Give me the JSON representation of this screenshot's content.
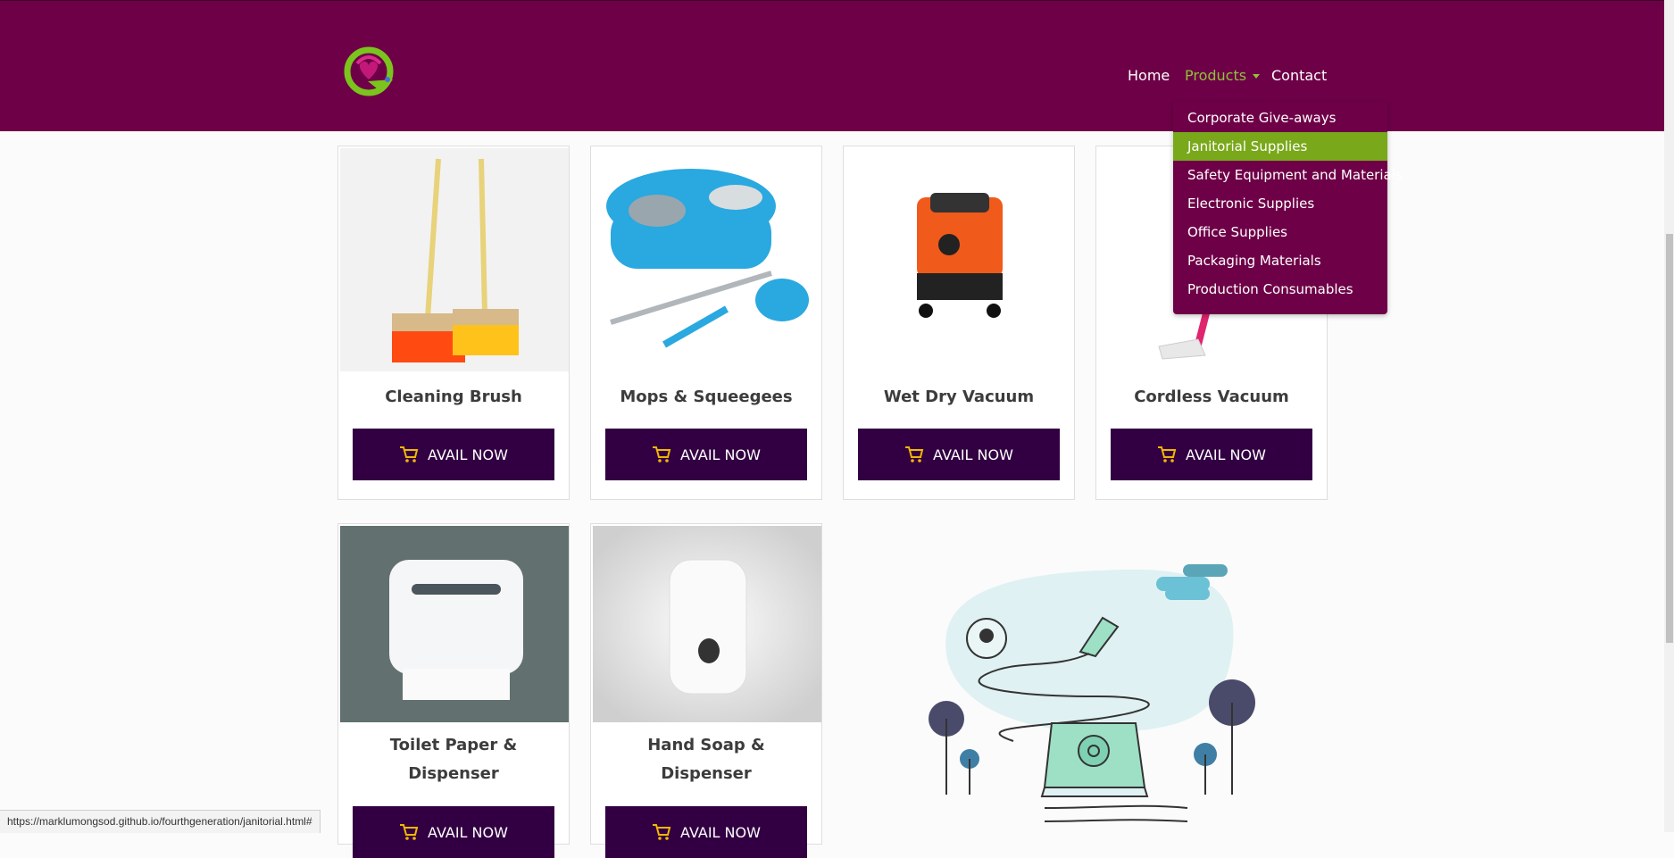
{
  "nav": {
    "home": "Home",
    "products": "Products",
    "contact": "Contact"
  },
  "dropdown": {
    "items": [
      "Corporate Give-aways",
      "Janitorial Supplies",
      "Safety Equipment and Materials",
      "Electronic Supplies",
      "Office Supplies",
      "Packaging Materials",
      "Production Consumables"
    ],
    "active_index": 1
  },
  "products": [
    {
      "title": "Cleaning Brush",
      "button": "AVAIL NOW"
    },
    {
      "title": "Mops & Squeegees",
      "button": "AVAIL NOW"
    },
    {
      "title": "Wet Dry Vacuum",
      "button": "AVAIL NOW"
    },
    {
      "title": "Cordless Vacuum",
      "button": "AVAIL NOW"
    },
    {
      "title": "Toilet Paper & Dispenser",
      "title_line1": "Toilet Paper &",
      "title_line2": "Dispenser",
      "button": "AVAIL NOW"
    },
    {
      "title": "Hand Soap & Dispenser",
      "title_line1": "Hand Soap &",
      "title_line2": "Dispenser",
      "button": "AVAIL NOW"
    }
  ],
  "status_url": "https://marklumongsod.github.io/fourthgeneration/janitorial.html#",
  "colors": {
    "navbar": "#6e0047",
    "button": "#320042",
    "active_link": "#8fc23a",
    "dropdown_active": "#79a81a",
    "cart_icon": "#f2b705"
  },
  "icons": [
    "logo",
    "cart-icon"
  ]
}
